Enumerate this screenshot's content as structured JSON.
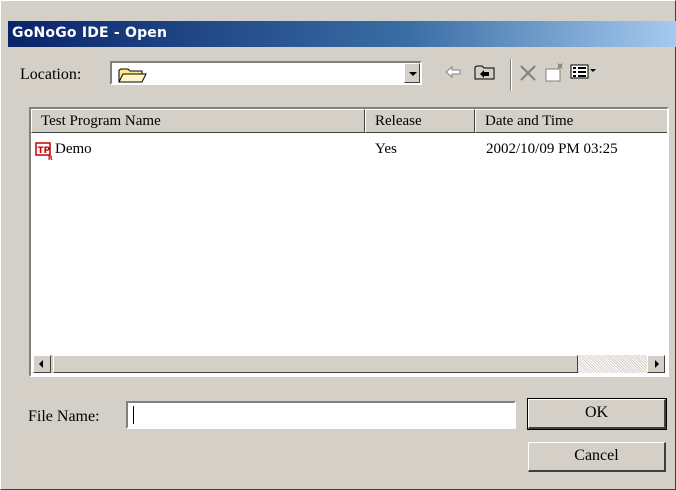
{
  "window": {
    "title": "GoNoGo IDE - Open"
  },
  "toolbar": {
    "location_label": "Location:",
    "location_value": "",
    "icons": [
      "folder-icon",
      "back-arrow-icon",
      "up-folder-icon",
      "delete-icon",
      "new-folder-icon",
      "view-menu-icon"
    ]
  },
  "list": {
    "columns": [
      "Test Program Name",
      "Release",
      "Date and Time"
    ],
    "rows": [
      {
        "name": "Demo",
        "release": "Yes",
        "datetime": "2002/10/09 PM 03:25",
        "icon": "test-program-icon"
      }
    ]
  },
  "form": {
    "file_name_label": "File Name:",
    "file_name_value": ""
  },
  "buttons": {
    "ok": "OK",
    "cancel": "Cancel"
  },
  "colors": {
    "title_bar_start": "#0a246a",
    "title_bar_end": "#a6caf0",
    "dialog_bg": "#d4d0c8"
  }
}
